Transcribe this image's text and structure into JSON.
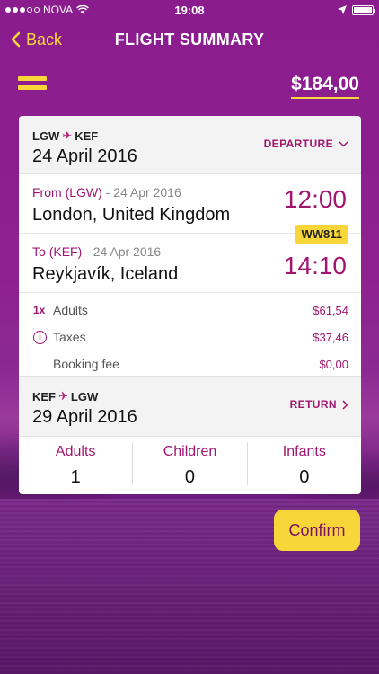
{
  "status": {
    "carrier": "NOVA",
    "time": "19:08"
  },
  "nav": {
    "back_label": "Back",
    "title": "FLIGHT SUMMARY"
  },
  "price": "$184,00",
  "departure": {
    "origin": "LGW",
    "destination": "KEF",
    "date": "24 April 2016",
    "direction_label": "DEPARTURE",
    "from": {
      "label": "From",
      "code": "(LGW)",
      "date": " - 24 Apr 2016",
      "city": "London, United Kingdom",
      "time": "12:00"
    },
    "to": {
      "label": "To",
      "code": "(KEF)",
      "date": " - 24 Apr 2016",
      "city": "Reykjavík, Iceland",
      "time": "14:10"
    },
    "flight_number": "WW811"
  },
  "fares": [
    {
      "prefix": "1x",
      "label": "Adults",
      "value": "$61,54"
    },
    {
      "prefix": "i",
      "label": "Taxes",
      "value": "$37,46"
    },
    {
      "prefix": "",
      "label": "Booking fee",
      "value": "$0,00"
    }
  ],
  "return": {
    "origin": "KEF",
    "destination": "LGW",
    "date": "29 April 2016",
    "direction_label": "RETURN"
  },
  "passengers": [
    {
      "label": "Adults",
      "count": "1"
    },
    {
      "label": "Children",
      "count": "0"
    },
    {
      "label": "Infants",
      "count": "0"
    }
  ],
  "confirm_label": "Confirm"
}
